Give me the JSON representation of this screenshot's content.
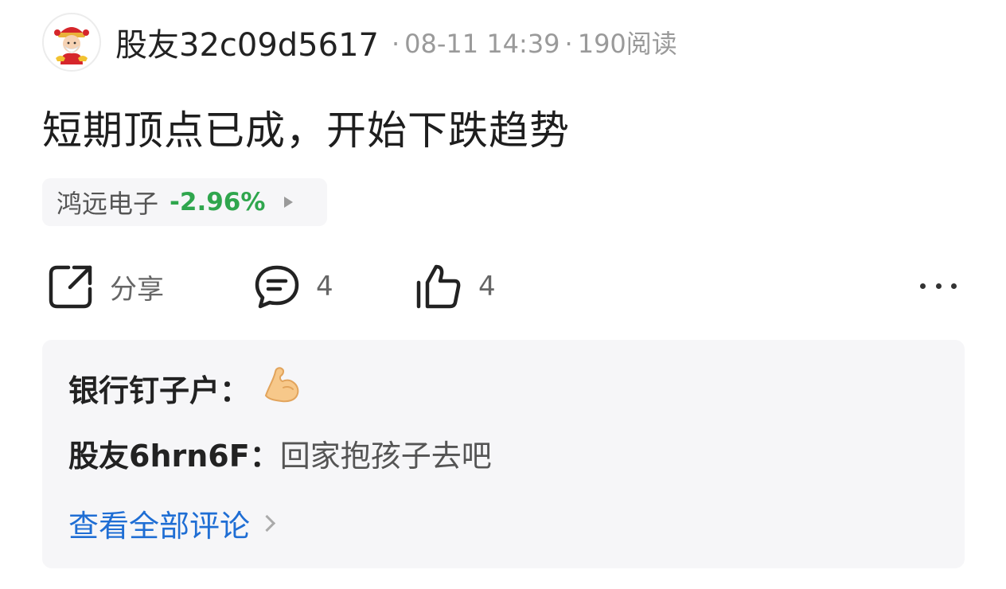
{
  "post": {
    "username": "股友32c09d5617",
    "date": "08-11 14:39",
    "separator": "·",
    "reads": "190阅读",
    "avatar_icon": "fortune-god-avatar-icon",
    "title": "短期顶点已成，开始下跌趋势"
  },
  "stock": {
    "name": "鸿远电子",
    "change": "-2.96%",
    "change_color": "#2fa64d",
    "arrow_icon": "triangle-right-icon"
  },
  "actions": {
    "share_label": "分享",
    "share_icon": "share-icon",
    "comment_count": "4",
    "comment_icon": "comment-bubble-icon",
    "like_count": "4",
    "like_icon": "thumbs-up-icon",
    "more_icon": "more-dots-icon"
  },
  "comments": {
    "items": [
      {
        "author": "银行钉子户",
        "colon": "：",
        "text": "",
        "emoji": "flexed-biceps-icon"
      },
      {
        "author": "股友6hrn6F",
        "colon": "：",
        "text": "回家抱孩子去吧"
      }
    ],
    "view_all_label": "查看全部评论",
    "link_color": "#1f6ed4"
  }
}
